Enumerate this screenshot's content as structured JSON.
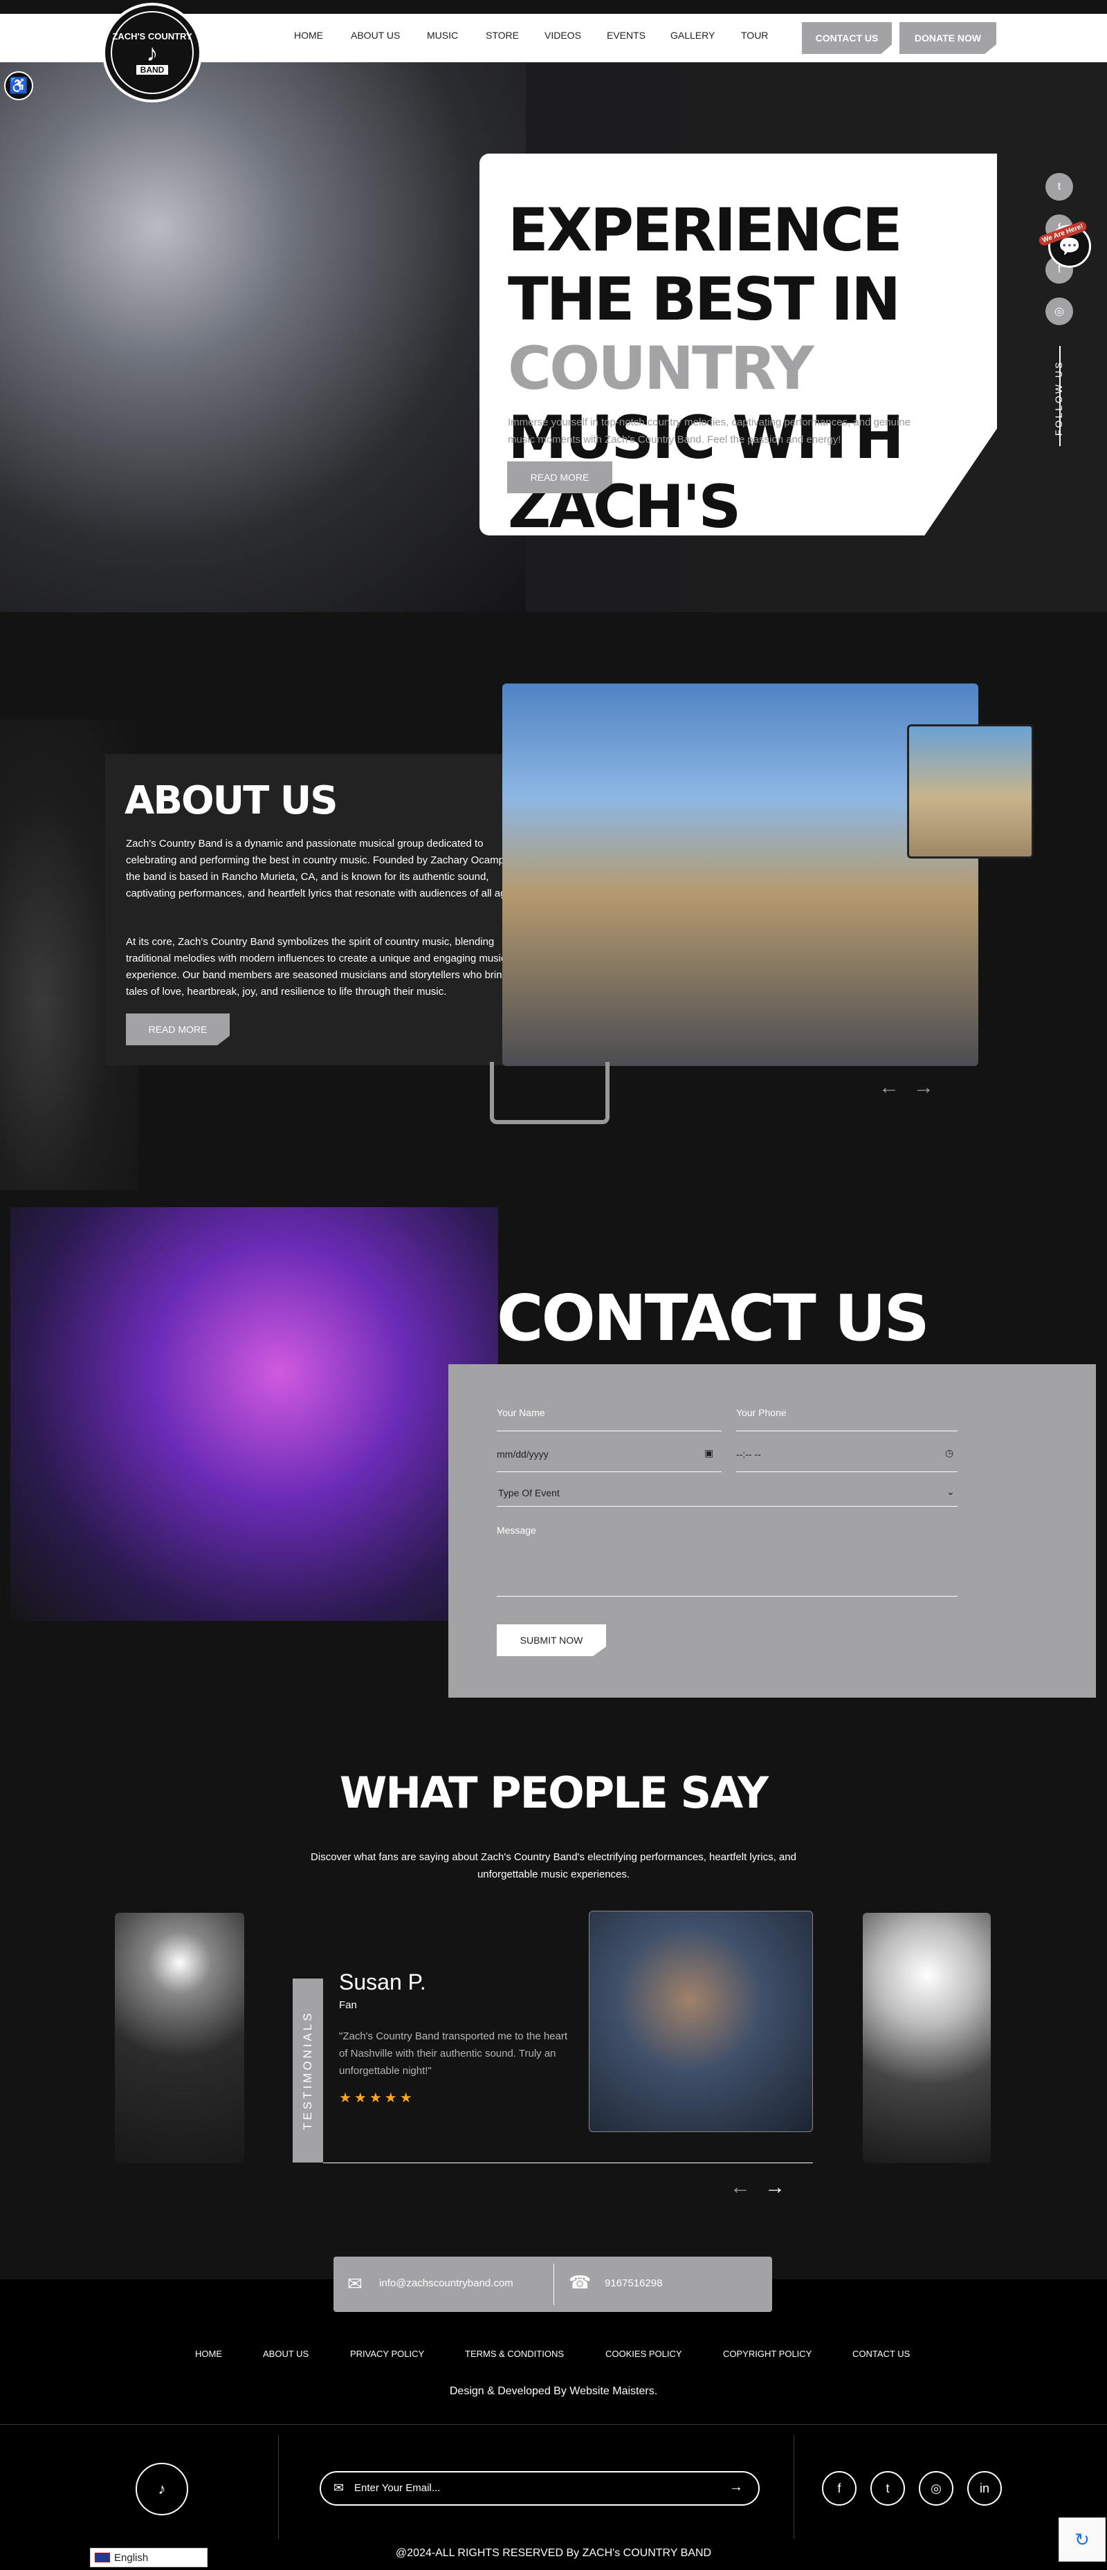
{
  "brand": {
    "logo_top": "ZACH'S COUNTRY",
    "logo_bottom": "BAND"
  },
  "nav": {
    "items": [
      "HOME",
      "ABOUT US",
      "MUSIC",
      "STORE",
      "VIDEOS",
      "EVENTS",
      "GALLERY",
      "TOUR"
    ],
    "contact_label": "CONTACT US",
    "donate_label": "DONATE NOW"
  },
  "hero": {
    "title_line1": "EXPERIENCE THE BEST IN",
    "title_accent": "COUNTRY",
    "title_line2_rest": " MUSIC WITH",
    "title_line3": "ZACH'S",
    "description": "Immerse yourself in top-notch country melodies, captivating performances, and genuine music moments with Zach's Country Band. Feel the passion and energy!",
    "button_label": "READ MORE",
    "follow_label": "FOLLOW US",
    "chat_badge": "We Are Here!"
  },
  "about": {
    "title": "ABOUT US",
    "paragraph1": "Zach's Country Band is a dynamic and passionate musical group dedicated to celebrating and performing the best in country music. Founded by Zachary Ocampo, the band is based in Rancho Murieta, CA, and is known for its authentic sound, captivating performances, and heartfelt lyrics that resonate with audiences of all ages.",
    "paragraph2": "At its core, Zach's Country Band symbolizes the spirit of country music, blending traditional melodies with modern influences to create a unique and engaging musical experience. Our band members are seasoned musicians and storytellers who bring tales of love, heartbreak, joy, and resilience to life through their music.",
    "button_label": "READ MORE"
  },
  "contact": {
    "title": "CONTACT US",
    "name_placeholder": "Your Name",
    "phone_placeholder": "Your Phone",
    "date_placeholder": "mm/dd/yyyy",
    "time_placeholder": "--:-- --",
    "event_type_placeholder": "Type Of Event",
    "message_placeholder": "Message",
    "submit_label": "SUBMIT NOW"
  },
  "testimonials": {
    "title": "WHAT PEOPLE SAY",
    "description": "Discover what fans are saying about Zach's Country Band's electrifying performances, heartfelt lyrics, and unforgettable music experiences.",
    "side_label": "TESTIMONIALS",
    "name": "Susan P.",
    "role": "Fan",
    "quote": "\"Zach's Country Band transported me to the heart of Nashville with their authentic sound. Truly an unforgettable night!\"",
    "stars": "★★★★★"
  },
  "footer": {
    "email": "info@zachscountryband.com",
    "phone": "9167516298",
    "links": [
      "HOME",
      "ABOUT US",
      "PRIVACY POLICY",
      "TERMS & CONDITIONS",
      "COOKIES POLICY",
      "COPYRIGHT POLICY",
      "CONTACT US"
    ],
    "credit": "Design & Developed By Website Maisters.",
    "newsletter_placeholder": "Enter Your Email...",
    "copyright": "@2024-ALL RIGHTS RESERVED By ZACH's COUNTRY BAND",
    "language": "English"
  },
  "colors": {
    "accent_grey": "#a3a3a6",
    "background": "#131313",
    "star": "#f5a623"
  },
  "icons": [
    "accessibility-icon",
    "twitter-icon",
    "facebook-icon",
    "instagram-icon",
    "chat-icon",
    "arrow-left-icon",
    "arrow-right-icon",
    "mail-icon",
    "headset-icon",
    "send-icon",
    "linkedin-icon",
    "flag-icon",
    "recaptcha-icon"
  ]
}
